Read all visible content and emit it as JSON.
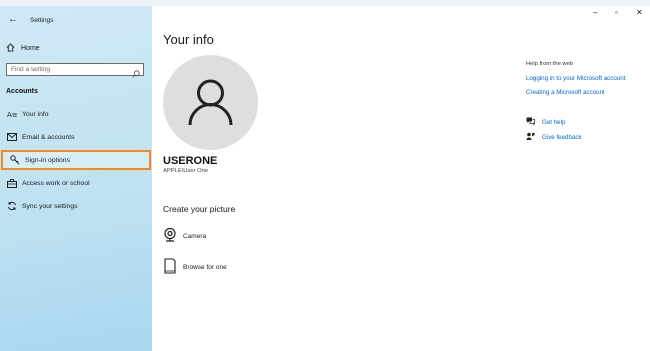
{
  "window": {
    "title": "Settings",
    "controls": {
      "minimize": "–",
      "maximize": "▫",
      "close": "✕"
    }
  },
  "sidebar": {
    "home_label": "Home",
    "search_placeholder": "Find a setting",
    "section_title": "Accounts",
    "items": [
      {
        "label": "Your info",
        "icon": "person-list-icon"
      },
      {
        "label": "Email & accounts",
        "icon": "mail-icon"
      },
      {
        "label": "Sign-in options",
        "icon": "key-icon",
        "selected": true
      },
      {
        "label": "Access work or school",
        "icon": "briefcase-icon"
      },
      {
        "label": "Sync your settings",
        "icon": "sync-icon"
      }
    ]
  },
  "main": {
    "title": "Your info",
    "user_name": "USERONE",
    "account_name": "APPLE\\User One",
    "create_picture_title": "Create your picture",
    "picture_options": [
      {
        "label": "Camera",
        "icon": "camera-icon"
      },
      {
        "label": "Browse for one",
        "icon": "browse-icon"
      }
    ]
  },
  "help": {
    "title": "Help from the web",
    "links": [
      "Logging in to your Microsoft account",
      "Creating a Microsoft account"
    ],
    "get_help": "Get help",
    "give_feedback": "Give feedback"
  },
  "colors": {
    "accent_link": "#0a66c2",
    "selected_outline": "#f08a24",
    "sidebar_bg": "#bfe2f2"
  }
}
